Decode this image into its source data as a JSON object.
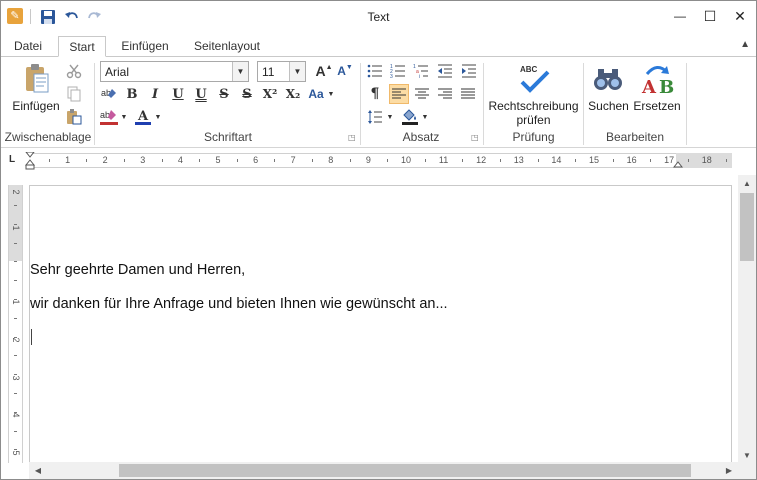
{
  "window": {
    "title": "Text",
    "app_icon": "rich-edit-icon",
    "accent": "#e8a33c"
  },
  "quick_access": {
    "save_icon": "save-icon",
    "undo_icon": "undo-icon",
    "redo_icon": "redo-icon"
  },
  "window_controls": {
    "minimize": "—",
    "maximize": "☐",
    "close": "✕"
  },
  "tabs": [
    {
      "label": "Datei"
    },
    {
      "label": "Start",
      "active": true
    },
    {
      "label": "Einfügen"
    },
    {
      "label": "Seitenlayout"
    }
  ],
  "ribbon": {
    "clipboard": {
      "label": "Zwischenablage",
      "paste_label": "Einfügen"
    },
    "font": {
      "label": "Schriftart",
      "font_name": "Arial",
      "font_size": "11",
      "bold": "B",
      "italic": "I",
      "underline": "U",
      "double_underline": "U",
      "strikethrough": "S",
      "double_strikethrough": "S",
      "superscript": "X²",
      "subscript": "X₂",
      "change_case": "Aa",
      "grow_font": "A",
      "shrink_font": "A",
      "font_color_letter": "A",
      "font_color": "#1f3fb0",
      "highlight_color": "#c23232"
    },
    "paragraph": {
      "label": "Absatz",
      "pilcrow": "¶"
    },
    "proofing": {
      "label": "Prüfung",
      "spell_label_line1": "Rechtschreibung",
      "spell_label_line2": "prüfen",
      "abc": "ABC"
    },
    "editing": {
      "label": "Bearbeiten",
      "find_label": "Suchen",
      "replace_label": "Ersetzen"
    }
  },
  "ruler": {
    "corner": "L",
    "numbers": [
      "1",
      "2",
      "3",
      "4",
      "5",
      "6",
      "7",
      "8",
      "9",
      "10",
      "11",
      "12",
      "13",
      "14",
      "15",
      "16",
      "17",
      "18"
    ],
    "vertical_numbers": [
      "2",
      "1",
      "1",
      "2",
      "3",
      "4",
      "5"
    ]
  },
  "document": {
    "lines": [
      "Sehr geehrte Damen und Herren,",
      "wir danken für Ihre Anfrage und bieten Ihnen wie gewünscht an..."
    ]
  }
}
